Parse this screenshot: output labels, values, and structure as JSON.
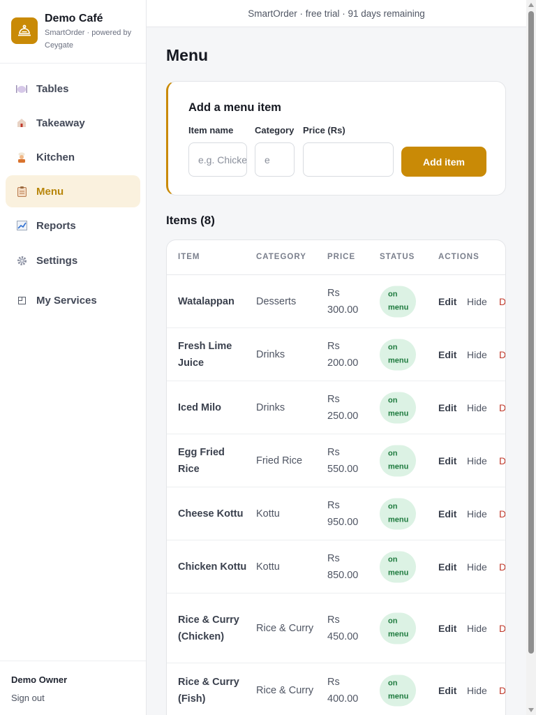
{
  "topbar": {
    "text": "SmartOrder · free trial · 91 days remaining"
  },
  "brand": {
    "name": "Demo Café",
    "subtitle": "SmartOrder · powered by Ceygate",
    "logo_icon": "cloche-icon"
  },
  "nav": {
    "items": [
      {
        "label": "Tables",
        "icon": "plate-icon"
      },
      {
        "label": "Takeaway",
        "icon": "house-icon"
      },
      {
        "label": "Kitchen",
        "icon": "chef-icon"
      },
      {
        "label": "Menu",
        "icon": "clipboard-icon",
        "active": true
      },
      {
        "label": "Reports",
        "icon": "chart-icon"
      },
      {
        "label": "Settings",
        "icon": "gear-icon"
      },
      {
        "label": "My Services",
        "icon": "window-icon"
      }
    ]
  },
  "user": {
    "name": "Demo Owner",
    "signout": "Sign out"
  },
  "page": {
    "title": "Menu"
  },
  "add_form": {
    "title": "Add a menu item",
    "name_label": "Item name",
    "name_placeholder": "e.g. Chicken Kottu",
    "category_label": "Category",
    "category_placeholder": "e",
    "price_label": "Price (Rs)",
    "price_value": "",
    "submit_label": "Add item"
  },
  "items": {
    "title": "Items (8)",
    "columns": [
      "ITEM",
      "CATEGORY",
      "PRICE",
      "STATUS",
      "ACTIONS"
    ],
    "actions": {
      "edit": "Edit",
      "hide": "Hide",
      "delete": "D"
    },
    "rows": [
      {
        "name": "Watalappan",
        "category": "Desserts",
        "price": "Rs 300.00",
        "status": "on menu"
      },
      {
        "name": "Fresh Lime Juice",
        "category": "Drinks",
        "price": "Rs 200.00",
        "status": "on menu"
      },
      {
        "name": "Iced Milo",
        "category": "Drinks",
        "price": "Rs 250.00",
        "status": "on menu"
      },
      {
        "name": "Egg Fried Rice",
        "category": "Fried Rice",
        "price": "Rs 550.00",
        "status": "on menu"
      },
      {
        "name": "Cheese Kottu",
        "category": "Kottu",
        "price": "Rs 950.00",
        "status": "on menu"
      },
      {
        "name": "Chicken Kottu",
        "category": "Kottu",
        "price": "Rs 850.00",
        "status": "on menu"
      },
      {
        "name": "Rice & Curry (Chicken)",
        "category": "Rice & Curry",
        "price": "Rs 450.00",
        "status": "on menu"
      },
      {
        "name": "Rice & Curry (Fish)",
        "category": "Rice & Curry",
        "price": "Rs 400.00",
        "status": "on menu"
      }
    ]
  },
  "colors": {
    "accent": "#c98a06",
    "active_bg": "#faf1de",
    "status_bg": "#dcf2e4",
    "status_text": "#1e7a3e",
    "danger": "#c0392b"
  }
}
